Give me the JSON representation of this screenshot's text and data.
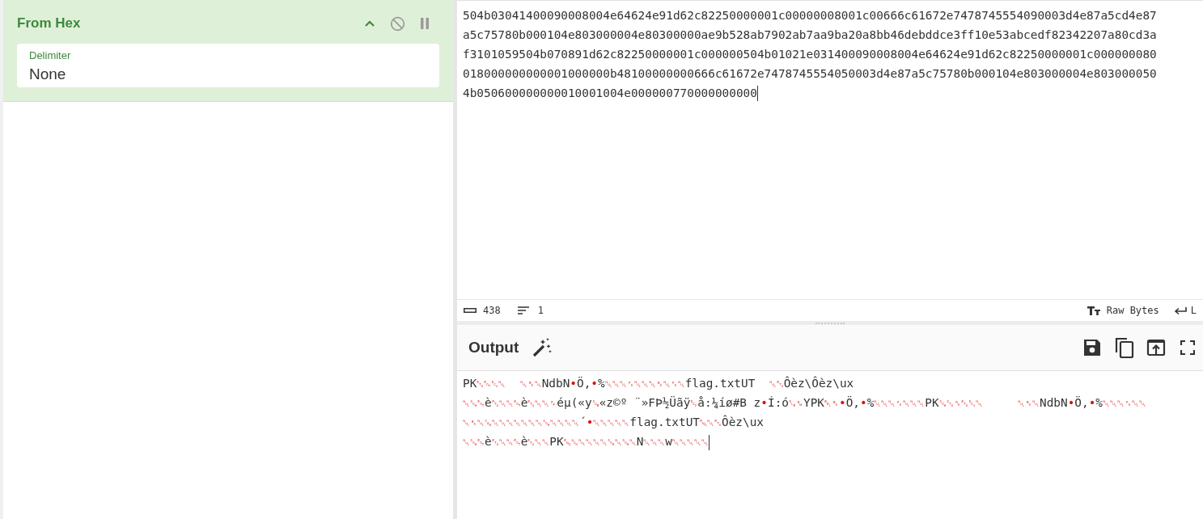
{
  "recipe": [
    {
      "title": "From Hex",
      "args": [
        {
          "label": "Delimiter",
          "value": "None"
        }
      ]
    }
  ],
  "input": {
    "lines": [
      "504b03041400090008004e64624e91d62c82250000001c00000008001c00666c61672e7478745554090003d4e87a5cd4e87",
      "a5c75780b000104e803000004e80300000ae9b528ab7902ab7aa9ba20a8bb46debddce3ff10e53abcedf82342207a80cd3a",
      "f3101059504b070891d62c82250000001c000000504b01021e031400090008004e64624e91d62c82250000001c000000080",
      "018000000000001000000b48100000000666c61672e7478745554050003d4e87a5c75780b000104e803000004e803000050",
      "4b050600000000010001004e000000770000000000"
    ]
  },
  "input_status": {
    "length": "438",
    "lines": "1",
    "encoding": "Raw Bytes",
    "eol": "L"
  },
  "output": {
    "title": "Output",
    "lines": [
      "PK␃␄␔␀  ␀␈␀NdbN•Ö,•%␀␀␀␜␀␀␀␈␀␜␀flag.txtUT  ␀␃Ôèz\\Ôèz\\ux",
      "␀␁␄è␃␀␀␄è␃␀␀␌éµ(«y␚«z©º ¨»FÞ½Üãÿ␒å:¼íø#B z•Í:ó␐␙YPK␇␈•Ö,•%␀␀␀␜␀␀␀PK␁␂␞␃␔␀     ␀␈␀NdbN•Ö,•%␀␀␀␜␀␀",
      "␀␈␀␘␀␀␀␀␀␀␀␁␀␀␀␀´•␀␀␀␀␀flag.txtUT␅␀␃Ôèz\\ux",
      "␀␁␄è␃␀␀␄è␃␀␀PK␅␆␀␀␀␀␁␀␁␀N␀␀␀w␀␀␀␀␀"
    ]
  }
}
